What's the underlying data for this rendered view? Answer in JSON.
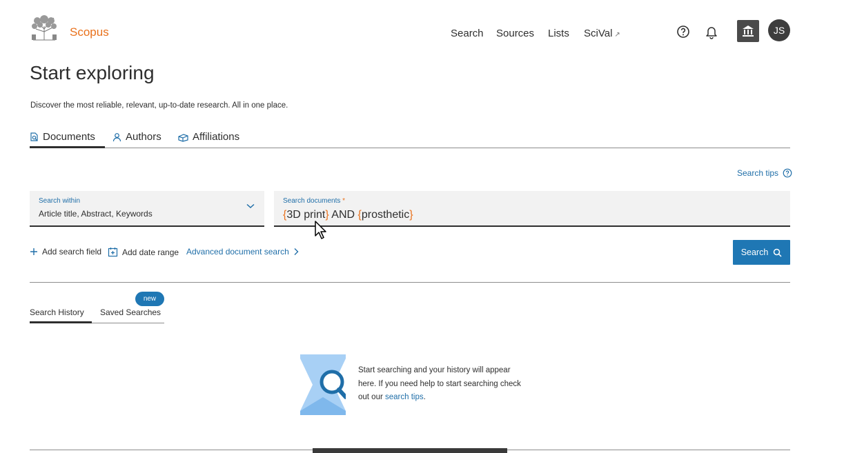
{
  "header": {
    "brand": "Scopus",
    "nav": [
      {
        "label": "Search"
      },
      {
        "label": "Sources"
      },
      {
        "label": "Lists"
      },
      {
        "label": "SciVal"
      }
    ],
    "scival_external_icon": "↗",
    "icons": [
      "help-icon",
      "bell-icon",
      "institution-icon"
    ],
    "avatar_initials": "JS"
  },
  "page": {
    "title": "Start exploring",
    "subtitle": "Discover the most reliable, relevant, up-to-date research. All in one place."
  },
  "tabs": [
    {
      "label": "Documents",
      "icon": "document-search-icon",
      "active": true
    },
    {
      "label": "Authors",
      "icon": "person-icon",
      "active": false
    },
    {
      "label": "Affiliations",
      "icon": "building-icon",
      "active": false
    }
  ],
  "search_tips_label": "Search tips",
  "search_within": {
    "label": "Search within",
    "value": "Article title, Abstract, Keywords"
  },
  "search_documents": {
    "label": "Search documents",
    "required_mark": "*",
    "query_parts": [
      "{",
      "3D print",
      "}",
      " AND ",
      "{",
      "prosthetic",
      "}"
    ]
  },
  "actions": {
    "add_search_field": "Add search field",
    "add_date_range": "Add date range",
    "advanced_search": "Advanced document search",
    "search_button": "Search"
  },
  "history": {
    "tabs": [
      "Search History",
      "Saved Searches"
    ],
    "new_badge": "new",
    "empty_text_1": "Start searching and your history will appear here. If you need help to start searching check out our ",
    "empty_link": "search tips",
    "empty_text_2": "."
  },
  "colors": {
    "brand": "#e9711c",
    "link": "#1f6ea8",
    "primary_button": "#1f77b4",
    "field_bg": "#f2f2f2"
  }
}
